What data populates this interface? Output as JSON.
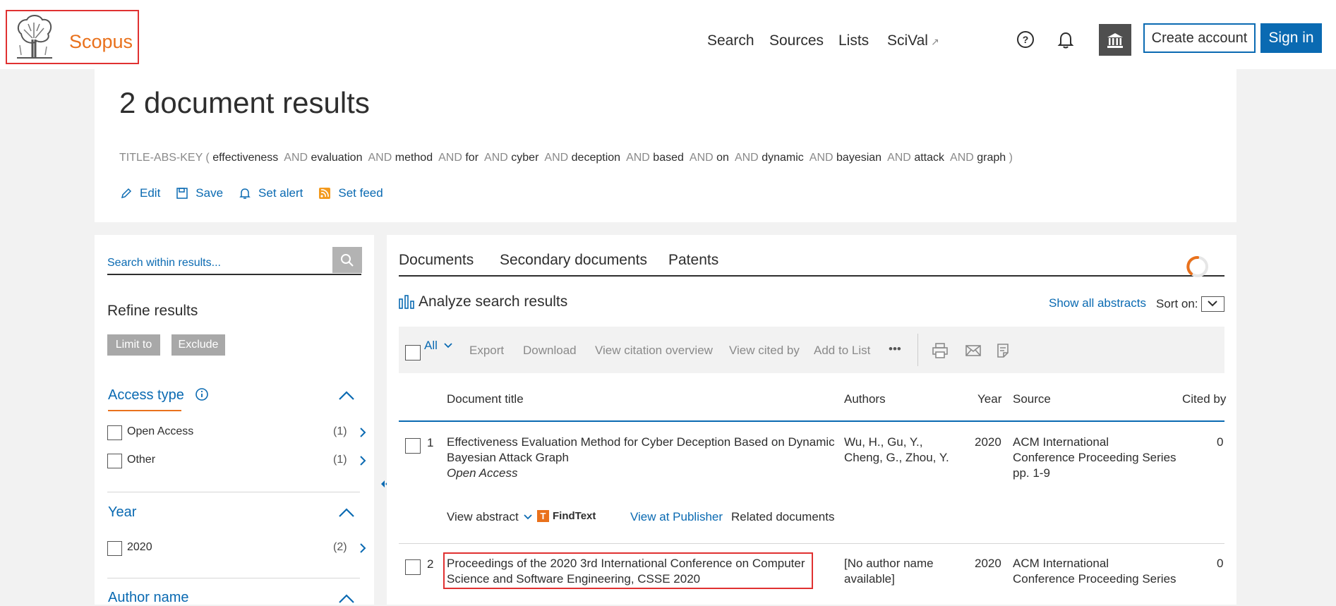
{
  "header": {
    "logo_text": "Scopus",
    "nav": [
      "Search",
      "Sources",
      "Lists",
      "SciVal"
    ],
    "nav_external_icon": "external-link-icon",
    "create_account": "Create account",
    "sign_in": "Sign in",
    "icons": [
      "help-icon",
      "bell-icon",
      "institution-icon"
    ],
    "brand_color": "#e9711c",
    "accent_color": "#0a6ab2"
  },
  "results": {
    "title": "2 document results",
    "query_prefix": "TITLE-ABS-KEY (",
    "query_terms": [
      "effectiveness",
      "evaluation",
      "method",
      "for",
      "cyber",
      "deception",
      "based",
      "on",
      "dynamic",
      "bayesian",
      "attack",
      "graph"
    ],
    "query_operator": "AND",
    "query_suffix": ")",
    "actions": [
      "Edit",
      "Save",
      "Set alert",
      "Set feed"
    ]
  },
  "sidebar": {
    "search_placeholder": "Search within results...",
    "refine_title": "Refine results",
    "limit_to": "Limit to",
    "exclude": "Exclude",
    "facets": [
      {
        "title": "Access type",
        "items": [
          {
            "label": "Open Access",
            "count": "(1)"
          },
          {
            "label": "Other",
            "count": "(1)"
          }
        ]
      },
      {
        "title": "Year",
        "items": [
          {
            "label": "2020",
            "count": "(2)"
          }
        ]
      },
      {
        "title": "Author name",
        "items": []
      }
    ]
  },
  "main": {
    "tabs": [
      "Documents",
      "Secondary documents",
      "Patents"
    ],
    "analyze": "Analyze search results",
    "show_all_abstracts": "Show all abstracts",
    "sort_on": "Sort on:",
    "toolbar": {
      "all": "All",
      "items": [
        "Export",
        "Download",
        "View citation overview",
        "View cited by",
        "Add to List"
      ],
      "more": "•••",
      "icons": [
        "print-icon",
        "email-icon",
        "bibliography-icon"
      ]
    },
    "columns": [
      "Document title",
      "Authors",
      "Year",
      "Source",
      "Cited by"
    ],
    "rows": [
      {
        "num": "1",
        "title_line1": "Effectiveness Evaluation Method for Cyber Deception Based on Dynamic",
        "title_line2": "Bayesian Attack Graph",
        "access": "Open Access",
        "authors_line1": "Wu, H., Gu, Y.,",
        "authors_line2": "Cheng, G., Zhou, Y.",
        "year": "2020",
        "source_line1": "ACM International",
        "source_line2": "Conference Proceeding Series",
        "source_line3": "pp. 1-9",
        "cited_by": "0",
        "view_abstract": "View abstract",
        "findtext": "FindText",
        "view_publisher": "View at Publisher",
        "related": "Related documents"
      },
      {
        "num": "2",
        "title_line1": "Proceedings of the 2020 3rd International Conference on Computer",
        "title_line2": "Science and Software Engineering, CSSE 2020",
        "authors_line1": "[No author name",
        "authors_line2": "available]",
        "year": "2020",
        "source_line1": "ACM International",
        "source_line2": "Conference Proceeding Series",
        "cited_by": "0"
      }
    ]
  }
}
